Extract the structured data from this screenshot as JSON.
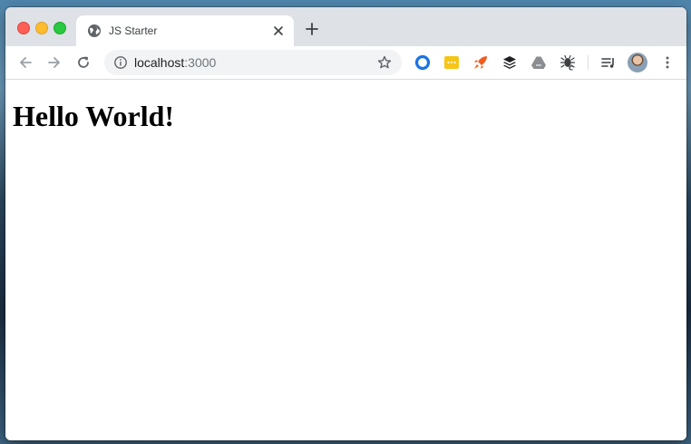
{
  "window": {
    "tab": {
      "title": "JS Starter",
      "favicon": "globe-icon"
    }
  },
  "toolbar": {
    "url_host": "localhost",
    "url_port": ":3000",
    "extensions": [
      "blue-ring-extension-icon",
      "yellow-chat-extension-icon",
      "orange-rocket-extension-icon",
      "buffer-stack-extension-icon",
      "drive-extension-icon",
      "bug-extension-icon",
      "media-queue-icon"
    ]
  },
  "page": {
    "heading": "Hello World!"
  },
  "colors": {
    "tabstrip": "#dee1e6",
    "omnibox": "#f1f3f4",
    "traffic_close": "#ff5f57",
    "traffic_min": "#febc2e",
    "traffic_max": "#28c840"
  }
}
